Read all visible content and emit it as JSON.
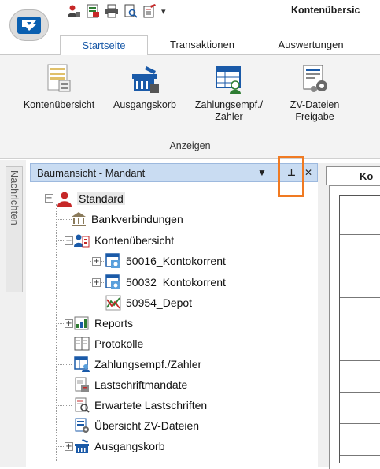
{
  "window": {
    "title": "Kontenübersic"
  },
  "quick_access": {
    "icons": [
      "user-settings-icon",
      "excel-export-icon",
      "print-icon",
      "print-preview-icon",
      "document-edit-icon"
    ],
    "dropdown_glyph": "▾"
  },
  "tabs": [
    {
      "label": "Startseite",
      "active": true
    },
    {
      "label": "Transaktionen",
      "active": false
    },
    {
      "label": "Auswertungen",
      "active": false
    }
  ],
  "ribbon": {
    "buttons": [
      {
        "label": "Kontenübersicht",
        "icon": "account-overview-icon"
      },
      {
        "label": "Ausgangskorb",
        "icon": "outbox-basket-icon"
      },
      {
        "label": "Zahlungsempf./ Zahler",
        "icon": "payee-icon"
      },
      {
        "label": "ZV-Dateien Freigabe",
        "icon": "file-release-icon"
      }
    ],
    "group_label": "Anzeigen"
  },
  "side_tab": {
    "label": "Nachrichten"
  },
  "panel": {
    "title": "Baumansicht - Mandant",
    "menu_glyph": "▼",
    "pin_glyph": "⊥",
    "close_glyph": "✕"
  },
  "tree": {
    "root": {
      "label": "Standard",
      "icon": "user-icon"
    },
    "items": [
      {
        "label": "Bankverbindungen",
        "icon": "bank-icon"
      },
      {
        "label": "Kontenübersicht",
        "icon": "account-tree-icon"
      },
      {
        "label": "50016_Kontokorrent",
        "icon": "current-account-icon"
      },
      {
        "label": "50032_Kontokorrent",
        "icon": "current-account-icon"
      },
      {
        "label": "50954_Depot",
        "icon": "depot-chart-icon"
      },
      {
        "label": "Reports",
        "icon": "reports-icon"
      },
      {
        "label": "Protokolle",
        "icon": "protocol-book-icon"
      },
      {
        "label": "Zahlungsempf./Zahler",
        "icon": "payee-list-icon"
      },
      {
        "label": "Lastschriftmandate",
        "icon": "direct-debit-mandate-icon"
      },
      {
        "label": "Erwartete Lastschriften",
        "icon": "expected-debits-icon"
      },
      {
        "label": "Übersicht ZV-Dateien",
        "icon": "payment-files-icon"
      },
      {
        "label": "Ausgangskorb",
        "icon": "outbox-basket-icon"
      }
    ]
  },
  "document": {
    "tab_label": "Ko"
  },
  "colors": {
    "accent": "#1a5aa8",
    "panel_header": "#c9dcf2",
    "highlight": "#f07a22",
    "brand_blue": "#0a5fb0"
  }
}
